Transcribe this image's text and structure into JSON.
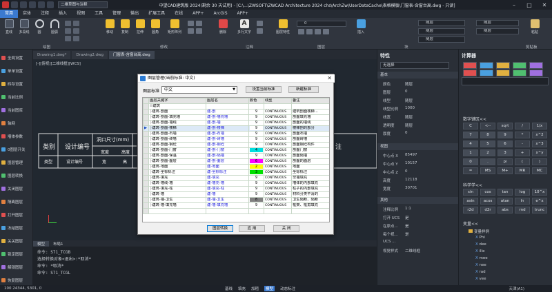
{
  "window": {
    "title": "中望CAD建筑版 2024(剩余 30 天试用) - [C:\\...\\ZWSOFT\\ZWCAD Architecture 2024 chs\\ArchZw\\UserDataCache\\表格模板\\门窗表-含窗台高.dwg - 只读]",
    "workspace": "二维草图与注释"
  },
  "menu": [
    "常用",
    "实体",
    "注释",
    "插入",
    "视图",
    "工具",
    "管理",
    "输出",
    "扩展工具",
    "在线",
    "APP+",
    "ArcGIS",
    "APP+"
  ],
  "ribbon": {
    "buttons": [
      {
        "label": "直线",
        "color": "#e8e8e8"
      },
      {
        "label": "多段线",
        "color": "#e8e8e8"
      },
      {
        "label": "圆",
        "color": "#e8e8e8"
      },
      {
        "label": "圆弧",
        "color": "#e8e8e8"
      },
      {
        "label": "移动",
        "color": "#f0c030"
      },
      {
        "label": "复制",
        "color": "#f0c030"
      },
      {
        "label": "拉伸",
        "color": "#f0c030"
      },
      {
        "label": "圆角",
        "color": "#f0c030"
      },
      {
        "label": "矩形阵列",
        "color": "#f0c030"
      },
      {
        "label": "删除",
        "color": "#e04848"
      },
      {
        "label": "多行文字",
        "color": "#e8e8e8"
      },
      {
        "label": "图层特性",
        "color": "#f0c030"
      },
      {
        "label": "插入",
        "color": "#4aa0e0"
      },
      {
        "label": "粘贴",
        "color": "#e0c070"
      }
    ],
    "groups": [
      "绘图",
      "修改",
      "注释",
      "图层",
      "块",
      "剪贴板"
    ],
    "combos": {
      "layer1": "0",
      "bylayer1": "随层",
      "bylayer2": "随层",
      "bylayer3": "随层",
      "bylayer4": "随层",
      "bylayer5": "随层"
    }
  },
  "left_panel": {
    "items": [
      "全局设置",
      "单单设置",
      "砖存设置",
      "当前比例",
      "当前图库",
      "轴网",
      "墙体参数",
      "0图层开关",
      "图层管理",
      "图层转换",
      "关闭图层",
      "隔离图层",
      "打开图层",
      "冻结图层",
      "关关图层",
      "锁定图层",
      "解锁图层",
      "恢复图层"
    ]
  },
  "doc_tabs": [
    "Drawing1.dwg*",
    "Drawing2.dwg",
    "门窗表-含窗台高.dwg"
  ],
  "view_label": "[-][俯视][二维线框][WCS]",
  "bg_table": {
    "header1": "类别",
    "header2": "设计编号",
    "header3": "洞口尺寸(mm)",
    "sub1": "宽度",
    "sub2": "高度",
    "row1": "类型",
    "row2": "设计编号",
    "row3": "宽",
    "row4": "高",
    "remark": "注"
  },
  "bottom_tabs": {
    "model": "模型",
    "layout": "布局1"
  },
  "cmd": {
    "lines": [
      "命令: S71_TCGB",
      "选择转换对象<退出>:*取消*",
      "命令: *取消*",
      "命令: S71_TCGL"
    ]
  },
  "status": {
    "coords": "100  24344, 5301, 0",
    "modes": [
      "基线",
      "填充",
      "加粗",
      "模型",
      "动态标注"
    ],
    "right": "天津(A1)"
  },
  "properties": {
    "title": "特性",
    "selection": "无选择",
    "sections": {
      "basic": "基本",
      "view": "视图",
      "other": "其他"
    },
    "basic": [
      {
        "k": "颜色",
        "v": "随层"
      },
      {
        "k": "图层",
        "v": "0"
      },
      {
        "k": "线型",
        "v": "随层"
      },
      {
        "k": "线型比例",
        "v": "1000"
      },
      {
        "k": "线宽",
        "v": "随层"
      },
      {
        "k": "透明度",
        "v": "随层"
      },
      {
        "k": "厚度",
        "v": "0"
      }
    ],
    "view": [
      {
        "k": "中心点 X",
        "v": "85497"
      },
      {
        "k": "中心点 Y",
        "v": "10157"
      },
      {
        "k": "中心点 Z",
        "v": "0"
      },
      {
        "k": "高度",
        "v": "12118"
      },
      {
        "k": "宽度",
        "v": "30701"
      }
    ],
    "other": [
      {
        "k": "注释比例",
        "v": "1:1"
      },
      {
        "k": "打开 UCS",
        "v": "是"
      },
      {
        "k": "在原点...",
        "v": "是"
      },
      {
        "k": "每个视...",
        "v": "是"
      },
      {
        "k": "UCS ...",
        "v": ""
      },
      {
        "k": "视觉样式",
        "v": "二维线框"
      }
    ]
  },
  "calculator": {
    "title": "计算器",
    "numpad_title": "数字键区<<",
    "numpad": [
      "C",
      "<--",
      "sqrt",
      "/",
      "1/x",
      "7",
      "8",
      "9",
      "*",
      "x^2",
      "4",
      "5",
      "6",
      "-",
      "x^3",
      "1",
      "2",
      "3",
      "+",
      "x^y",
      "0",
      ".",
      "pi",
      "(",
      ")",
      "=",
      "MS",
      "M+",
      "MR",
      "MC"
    ],
    "sci_title": "科学学<<",
    "sci": [
      "sin",
      "cos",
      "tan",
      "log",
      "10^x",
      "asin",
      "acos",
      "atan",
      "ln",
      "e^x",
      "r2d",
      "d2r",
      "abs",
      "rnd",
      "trunc"
    ],
    "vars_title": "变量<<",
    "vars_root": "变量样例",
    "vars": [
      "Phi",
      "dee",
      "ille",
      "mee",
      "nee",
      "rad",
      "vee"
    ]
  },
  "dialog": {
    "title": "图层管理(当前标准: 中文)",
    "std_label": "图层标准",
    "std_value": "中文",
    "btn_set": "设置当前标准",
    "btn_new": "新建标准",
    "columns": [
      "图层关键字",
      "图层名",
      "颜色",
      "线型",
      "备注"
    ],
    "rows": [
      {
        "key": "建筑",
        "name": "",
        "color": "",
        "ctext": "",
        "ltype": "",
        "note": ""
      },
      {
        "key": "建筑-剖面",
        "name": "建-剖",
        "color": "#ffffff",
        "ctext": "9",
        "ltype": "CONTINUOUS",
        "note": "建筑剖面楼梯..."
      },
      {
        "key": "建筑-剖面-填充墙",
        "name": "建-剖-墙充墙",
        "color": "#ffffff",
        "ctext": "9",
        "ltype": "CONTINUOUS",
        "note": "剖面填充墙"
      },
      {
        "key": "建筑-剖面-墙线",
        "name": "建-剖-墙",
        "color": "#ffffff",
        "ctext": "9",
        "ltype": "CONTINUOUS",
        "note": "剖面的墙线"
      },
      {
        "key": "建筑-剖面-楼梯",
        "name": "建-剖-楼梯",
        "color": "#ffffff",
        "ctext": "9",
        "ltype": "CONTINUOUS",
        "note": "楼梯剖的部分"
      },
      {
        "key": "建筑-剖面-石墙",
        "name": "建-剖-石墙",
        "color": "#ffffff",
        "ctext": "9",
        "ltype": "CONTINUOUS",
        "note": "剖面石墙"
      },
      {
        "key": "建筑-剖面-砖墙",
        "name": "建-剖-砖墙",
        "color": "#ffffff",
        "ctext": "9",
        "ltype": "CONTINUOUS",
        "note": "剖面砖墙"
      },
      {
        "key": "建筑-剖面-钢砼",
        "name": "建-剖-钢砼",
        "color": "#ffffff",
        "ctext": "9",
        "ltype": "CONTINUOUS",
        "note": "剖面钢砼构件"
      },
      {
        "key": "建筑-剖面-门窗",
        "name": "建-剖-门窗",
        "color": "#00e0e0",
        "ctext": "4",
        "ltype": "CONTINUOUS",
        "note": "剖面门窗"
      },
      {
        "key": "建筑-剖面-保温",
        "name": "建-剖-隔墙",
        "color": "#ffffff",
        "ctext": "9",
        "ltype": "CONTINUOUS",
        "note": "剖面隔墙"
      },
      {
        "key": "建筑-剖面-面层",
        "name": "建-剖-面层",
        "color": "#ff00ff",
        "ctext": "6",
        "ltype": "CONTINUOUS",
        "note": "剖面的面层"
      },
      {
        "key": "建筑-地面",
        "name": "建-地面",
        "color": "#ffff00",
        "ctext": "2",
        "ltype": "CONTINUOUS",
        "note": "地面"
      },
      {
        "key": "建筑-坐标标注",
        "name": "建-坐标标注",
        "color": "#00e000",
        "ctext": "3",
        "ltype": "CONTINUOUS",
        "note": "坐标标注"
      },
      {
        "key": "建筑-填充",
        "name": "建-填充",
        "color": "#ffffff",
        "ctext": "9",
        "ltype": "CONTINUOUS",
        "note": "非墙填充"
      },
      {
        "key": "建筑-墙线-墙",
        "name": "建-墙充-墙",
        "color": "#ffffff",
        "ctext": "9",
        "ltype": "CONTINUOUS",
        "note": "墙体的内部填充"
      },
      {
        "key": "建筑-填充-柱",
        "name": "建-填充-柱",
        "color": "#ffffff",
        "ctext": "9",
        "ltype": "CONTINUOUS",
        "note": "柱子的内部填充"
      },
      {
        "key": "建筑-墙",
        "name": "建-墙",
        "color": "#ffffff",
        "ctext": "9",
        "ltype": "CONTINUOUS",
        "note": "材料分类不清的"
      },
      {
        "key": "建筑-墙-卫生",
        "name": "建-墙-卫生",
        "color": "#808080",
        "ctext": "8",
        "ltype": "CONTINUOUS",
        "note": "卫生隔断、隔断"
      },
      {
        "key": "建筑-墙-填充墙",
        "name": "建-墙-填充墙",
        "color": "#ffffff",
        "ctext": "9",
        "ltype": "CONTINUOUS",
        "note": "框架、框剪填充"
      },
      {
        "key": "",
        "name": "",
        "color": "",
        "ctext": "",
        "ltype": "",
        "note": ""
      }
    ],
    "btn_convert": "图层转换",
    "btn_apply": "应 用",
    "btn_close": "关 闭"
  }
}
